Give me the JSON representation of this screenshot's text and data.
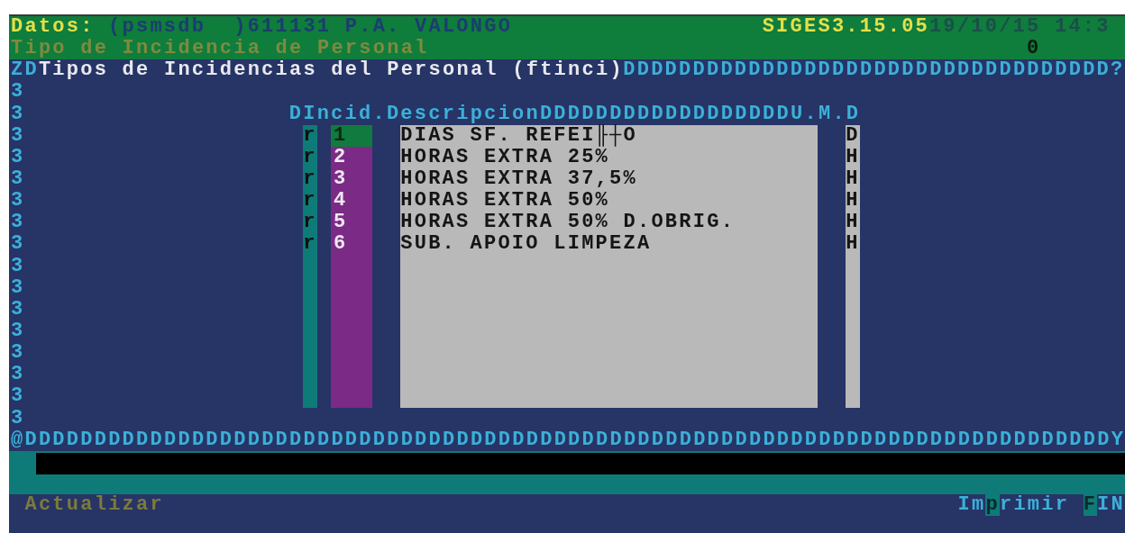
{
  "header": {
    "label": "Datos:",
    "info": "(psmsdb  )611131 P.A. VALONGO",
    "version": "SIGES3.15.05",
    "datetime": "19/10/15 14:3",
    "subtitle": "Tipo de Incidencia de Personal",
    "counter": "0"
  },
  "form": {
    "prefix": "ZD",
    "title": "Tipos de Incidencias del Personal (ftinci)",
    "border_fill": "DDDDDDDDDDDDDDDDDDDDDDDDDDDDDDDDDDD?",
    "left_border": [
      "3",
      "3",
      "3",
      "3",
      "3",
      "3",
      "3",
      "3",
      "3",
      "3",
      "3",
      "3",
      "3",
      "3",
      "3",
      "3"
    ],
    "column_header": "DIncid.DescripcionDDDDDDDDDDDDDDDDDDU.M.D",
    "rows": [
      {
        "marker": "r",
        "code": "1",
        "description": "DIAS SF. REFEI╟┼O",
        "unit": "D",
        "selected": true
      },
      {
        "marker": "r",
        "code": "2",
        "description": "HORAS EXTRA 25%",
        "unit": "H",
        "selected": false
      },
      {
        "marker": "r",
        "code": "3",
        "description": "HORAS EXTRA 37,5%",
        "unit": "H",
        "selected": false
      },
      {
        "marker": "r",
        "code": "4",
        "description": "HORAS EXTRA 50%",
        "unit": "H",
        "selected": false
      },
      {
        "marker": "r",
        "code": "5",
        "description": "HORAS EXTRA 50% D.OBRIG.",
        "unit": "H",
        "selected": false
      },
      {
        "marker": "r",
        "code": "6",
        "description": "SUB. APOIO LIMPEZA",
        "unit": "H",
        "selected": false
      }
    ],
    "bottom_border": "@DDDDDDDDDDDDDDDDDDDDDDDDDDDDDDDDDDDDDDDDDDDDDDDDDDDDDDDDDDDDDDDDDDDDDDDDDDDDDDY"
  },
  "footer": {
    "actions": [
      {
        "label": "Actualizar",
        "disabled": true
      },
      {
        "prefix": "Im",
        "hotkey": "p",
        "rest": "rimir",
        "disabled": false
      },
      {
        "hotkey": "F",
        "rest": "IN",
        "disabled": false
      }
    ]
  }
}
